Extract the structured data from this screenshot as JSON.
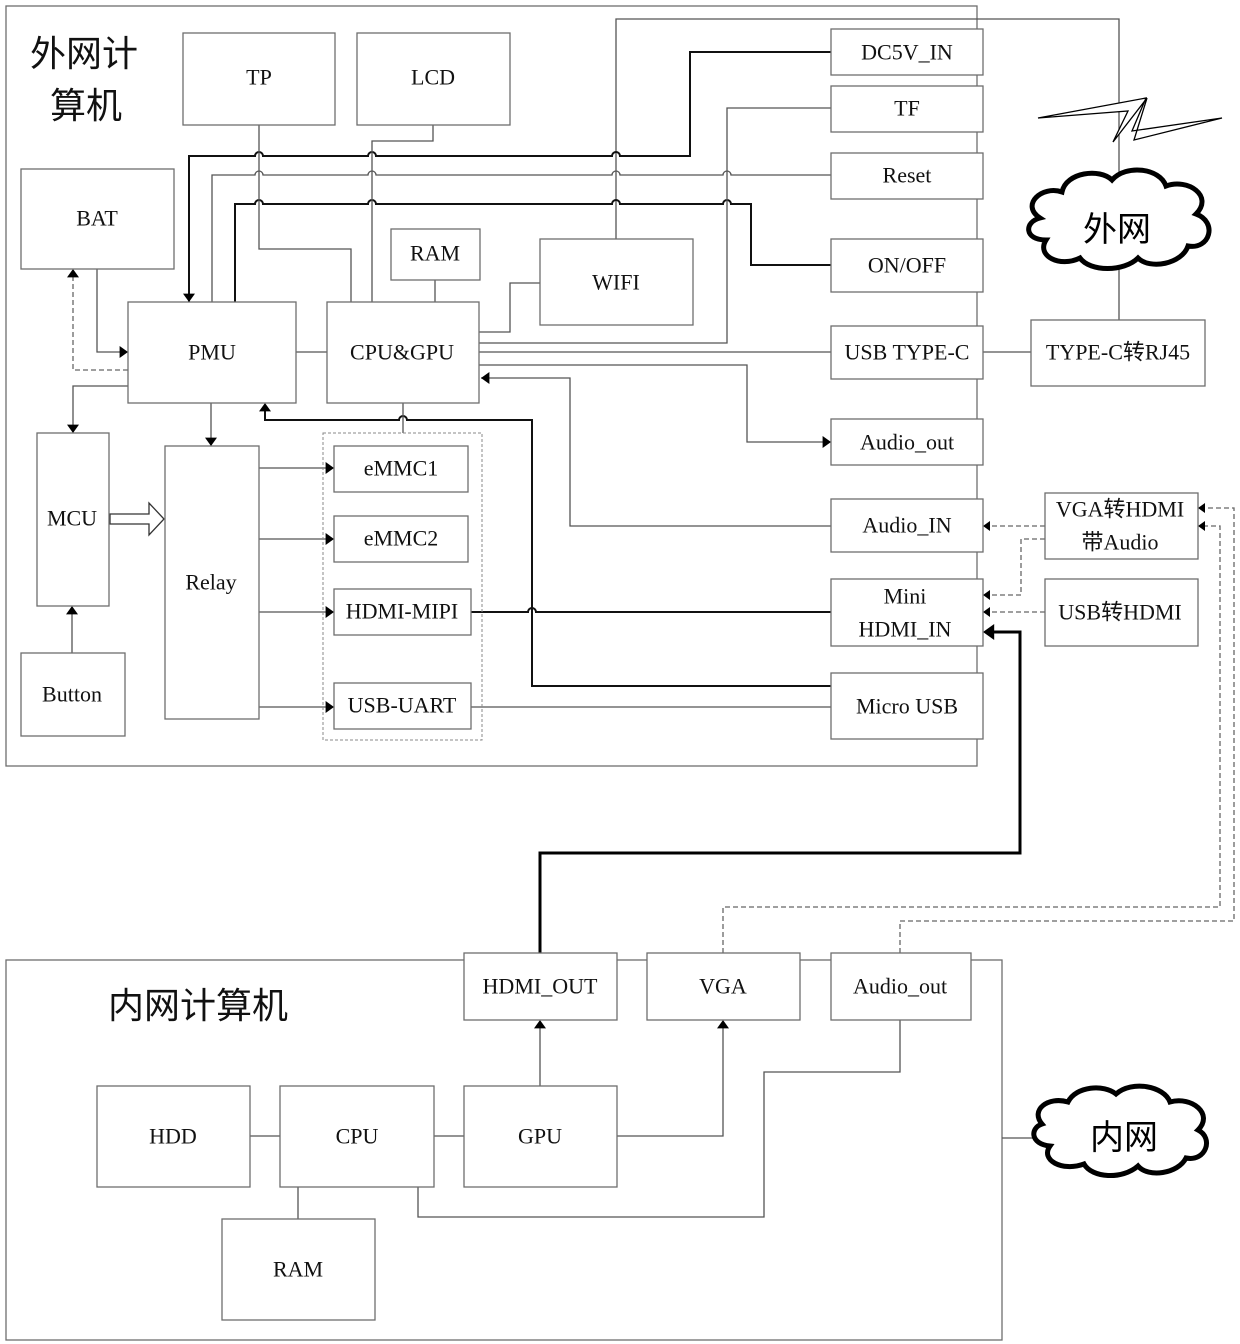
{
  "titles": {
    "outer_computer": [
      "外网计",
      "算机"
    ],
    "inner_computer": "内网计算机"
  },
  "clouds": {
    "external_network": "外网",
    "internal_network": "内网"
  },
  "outer_blocks": {
    "tp": "TP",
    "lcd": "LCD",
    "bat": "BAT",
    "ram": "RAM",
    "wifi": "WIFI",
    "pmu": "PMU",
    "cpu_gpu": "CPU&GPU",
    "mcu": "MCU",
    "relay": "Relay",
    "button": "Button",
    "emmc1": "eMMC1",
    "emmc2": "eMMC2",
    "hdmi_mipi": "HDMI-MIPI",
    "usb_uart": "USB-UART"
  },
  "ports": {
    "dc5v_in": "DC5V_IN",
    "tf": "TF",
    "reset": "Reset",
    "on_off": "ON/OFF",
    "usb_type_c": "USB TYPE-C",
    "audio_out": "Audio_out",
    "audio_in": "Audio_IN",
    "mini_hdmi_in": [
      "Mini",
      "HDMI_IN"
    ],
    "micro_usb": "Micro USB"
  },
  "adapters": {
    "typec_rj45": "TYPE-C转RJ45",
    "vga_hdmi_audio": [
      "VGA转HDMI",
      "带Audio"
    ],
    "usb_hdmi": "USB转HDMI"
  },
  "inner_blocks": {
    "hdmi_out": "HDMI_OUT",
    "vga": "VGA",
    "audio_out": "Audio_out",
    "hdd": "HDD",
    "cpu": "CPU",
    "gpu": "GPU",
    "ram": "RAM"
  }
}
